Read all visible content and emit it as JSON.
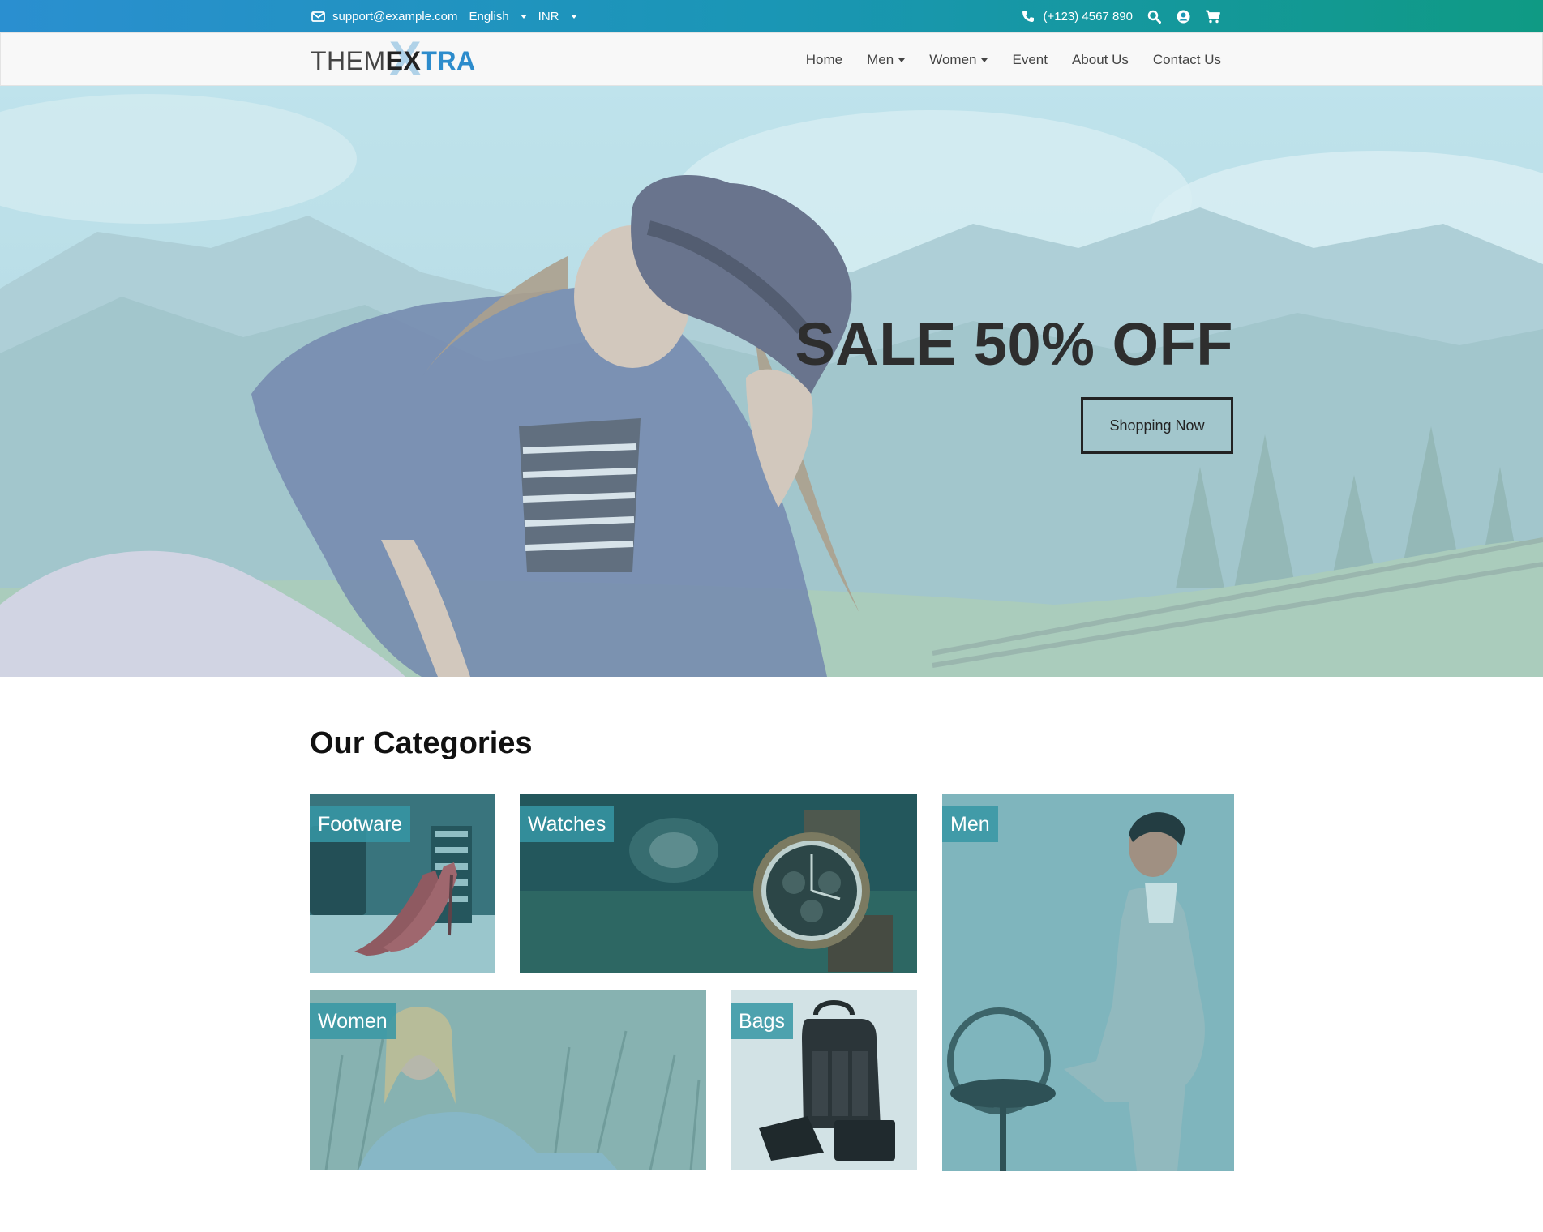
{
  "topbar": {
    "email": "support@example.com",
    "language": "English",
    "currency": "INR",
    "phone": "(+123) 4567 890",
    "icons": [
      "envelope-icon",
      "phone-icon",
      "search-icon",
      "user-icon",
      "cart-icon"
    ]
  },
  "logo": {
    "part1": "THEM",
    "big_x": "X",
    "part2": "EX",
    "part3": "TRA"
  },
  "nav": {
    "items": [
      {
        "label": "Home",
        "has_dropdown": false
      },
      {
        "label": "Men",
        "has_dropdown": true
      },
      {
        "label": "Women",
        "has_dropdown": true
      },
      {
        "label": "Event",
        "has_dropdown": false
      },
      {
        "label": "About Us",
        "has_dropdown": false
      },
      {
        "label": "Contact Us",
        "has_dropdown": false
      }
    ]
  },
  "hero": {
    "title": "SALE 50% OFF",
    "button": "Shopping Now"
  },
  "categories": {
    "heading": "Our Categories",
    "tiles": [
      {
        "label": "Footware"
      },
      {
        "label": "Watches"
      },
      {
        "label": "Men"
      },
      {
        "label": "Women"
      },
      {
        "label": "Bags"
      }
    ]
  },
  "colors": {
    "topbar_start": "#2a8fd0",
    "topbar_end": "#0f9a84",
    "brand_blue": "#2d8ccc",
    "label_bg": "#3696a5",
    "hero_title": "#2e2e2e"
  }
}
